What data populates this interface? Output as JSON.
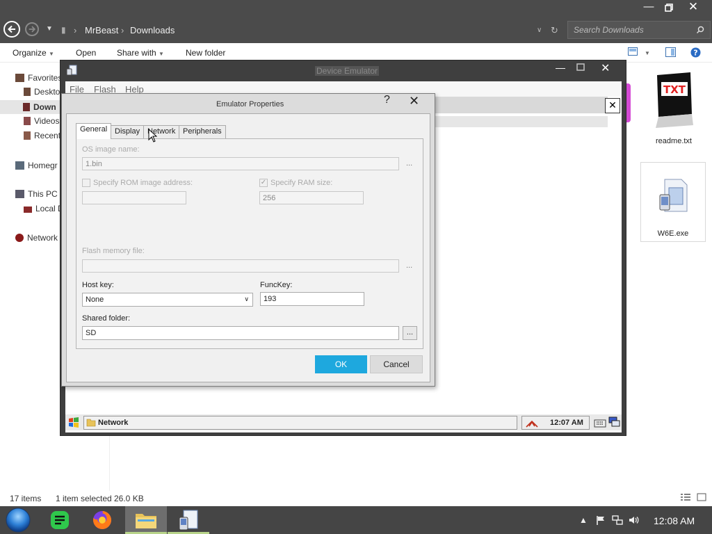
{
  "explorer": {
    "breadcrumb": [
      "MrBeast",
      "Downloads"
    ],
    "search_placeholder": "Search Downloads",
    "toolbar": {
      "organize": "Organize",
      "open": "Open",
      "share_with": "Share with",
      "new_folder": "New folder"
    },
    "nav": {
      "favorites": "Favorites",
      "desktop": "Deskto",
      "downloads": "Down",
      "videos": "Videos",
      "recent": "Recent",
      "homegroup": "Homegr",
      "this_pc": "This PC",
      "local_disk": "Local D",
      "network": "Network"
    },
    "files": [
      {
        "name": "readme.txt",
        "icon": "txt-file-icon",
        "badge": "TXT"
      },
      {
        "name": "W6E.exe",
        "icon": "exe-file-icon"
      }
    ],
    "status": {
      "items": "17 items",
      "selected": "1 item selected",
      "size": "26.0 KB"
    }
  },
  "taskbar": {
    "clock": "12:08 AM"
  },
  "emulator": {
    "title": "Device Emulator",
    "menu": {
      "file": "File",
      "flash": "Flash",
      "help": "Help"
    },
    "ce_taskbar": {
      "task": "Network",
      "time": "12:07 AM"
    }
  },
  "dialog": {
    "title": "Emulator Properties",
    "help_symbol": "?",
    "tabs": [
      "General",
      "Display",
      "Network",
      "Peripherals"
    ],
    "os_image_label": "OS image name:",
    "os_image_value": "1.bin",
    "rom_label": "Specify ROM image address:",
    "ram_label": "Specify RAM size:",
    "ram_value": "256",
    "flash_label": "Flash memory file:",
    "host_key_label": "Host key:",
    "host_key_value": "None",
    "funckey_label": "FuncKey:",
    "funckey_value": "193",
    "shared_folder_label": "Shared folder:",
    "shared_folder_value": "SD",
    "browse": "...",
    "ok": "OK",
    "cancel": "Cancel"
  },
  "colors": {
    "accent": "#1ea8de",
    "titlebar": "#4b4b4b",
    "taskbar": "#454545"
  }
}
